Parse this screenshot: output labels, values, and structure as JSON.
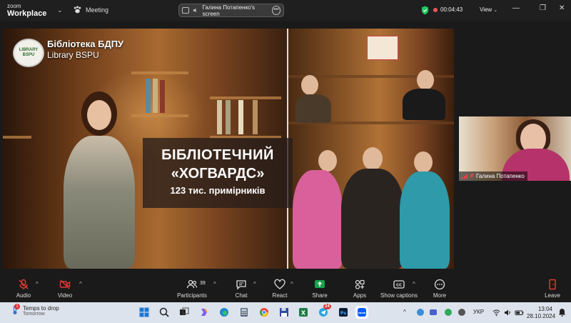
{
  "topbar": {
    "brand_line1": "zoom",
    "brand_line2": "Workplace",
    "meeting_label": "Meeting",
    "share_label": "Галина Потапенко's screen",
    "timer": "00:04:43",
    "view_label": "View"
  },
  "stage": {
    "logo_line1": "LIBRARY",
    "logo_line2": "BSPU",
    "library_title": "Бібліотека БДПУ",
    "library_subtitle": "Library BSPU",
    "caption_line1": "БІБЛІОТЕЧНИЙ",
    "caption_line2": "«ХОГВАРДС»",
    "caption_line3": "123 тис. примірників"
  },
  "participant": {
    "name": "Галина Потапенко"
  },
  "toolbar": {
    "audio_label": "Audio",
    "video_label": "Video",
    "participants_label": "Participants",
    "participants_count": "39",
    "chat_label": "Chat",
    "react_label": "React",
    "share_label": "Share",
    "apps_label": "Apps",
    "captions_label": "Show captions",
    "more_label": "More",
    "leave_label": "Leave"
  },
  "taskbar": {
    "weather_title": "Temps to drop",
    "weather_sub": "Tomorrow",
    "notif_count": "1",
    "telegram_badge": "24",
    "language": "УКР",
    "time": "13:04",
    "date": "28.10.2024"
  },
  "colors": {
    "accent_green": "#22c55e",
    "share_green": "#16a34a",
    "danger": "#e53935",
    "tile_sweater": "#b5336a"
  }
}
